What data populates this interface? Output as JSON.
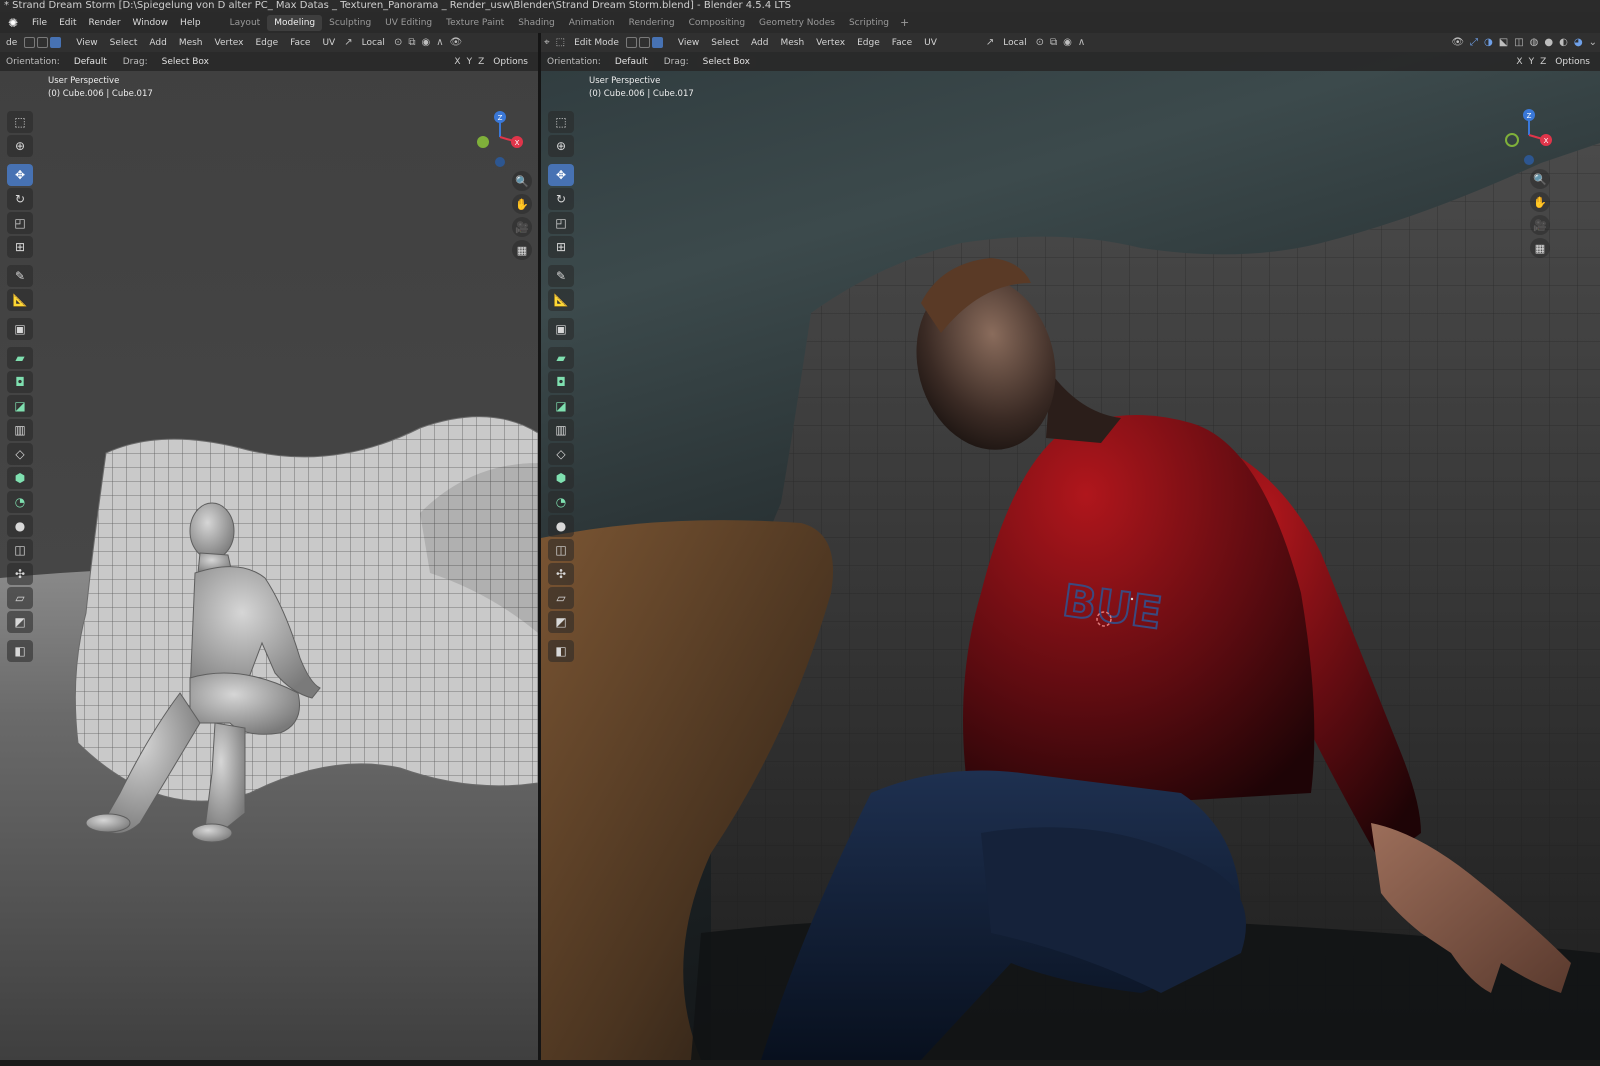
{
  "window": {
    "title": "* Strand Dream Storm [D:\\Spiegelung von D  alter PC_ Max Datas _ Texturen_Panorama _ Render_usw\\Blender\\Strand Dream Storm.blend] - Blender 4.5.4 LTS"
  },
  "menu": {
    "items": [
      "File",
      "Edit",
      "Render",
      "Window",
      "Help"
    ],
    "workspaces": [
      "Layout",
      "Modeling",
      "Sculpting",
      "UV Editing",
      "Texture Paint",
      "Shading",
      "Animation",
      "Rendering",
      "Compositing",
      "Geometry Nodes",
      "Scripting"
    ],
    "active_workspace": "Modeling",
    "add_symbol": "+"
  },
  "left_editor": {
    "mode_label": "de",
    "menus": [
      "View",
      "Select",
      "Add",
      "Mesh",
      "Vertex",
      "Edge",
      "Face",
      "UV"
    ],
    "pivot_label": "Local",
    "orientation_label": "Orientation:",
    "orientation_value": "Default",
    "drag_label": "Drag:",
    "drag_value": "Select Box",
    "axes": [
      "X",
      "Y",
      "Z"
    ],
    "options_label": "Options",
    "view_name": "User Perspective",
    "object_info": "(0) Cube.006 | Cube.017"
  },
  "right_editor": {
    "mode_label": "Edit Mode",
    "menus": [
      "View",
      "Select",
      "Add",
      "Mesh",
      "Vertex",
      "Edge",
      "Face",
      "UV"
    ],
    "pivot_label": "Local",
    "orientation_label": "Orientation:",
    "orientation_value": "Default",
    "drag_label": "Drag:",
    "drag_value": "Select Box",
    "axes": [
      "X",
      "Y",
      "Z"
    ],
    "options_label": "Options",
    "view_name": "User Perspective",
    "object_info": "(0) Cube.006 | Cube.017",
    "shirt_text": "BUE"
  },
  "gizmo": {
    "z_label": "Z",
    "x_label": "X"
  },
  "colors": {
    "active_blue": "#4772b3",
    "axis_x": "#e0354a",
    "axis_y": "#7fb03a",
    "axis_z": "#3a78d8"
  }
}
